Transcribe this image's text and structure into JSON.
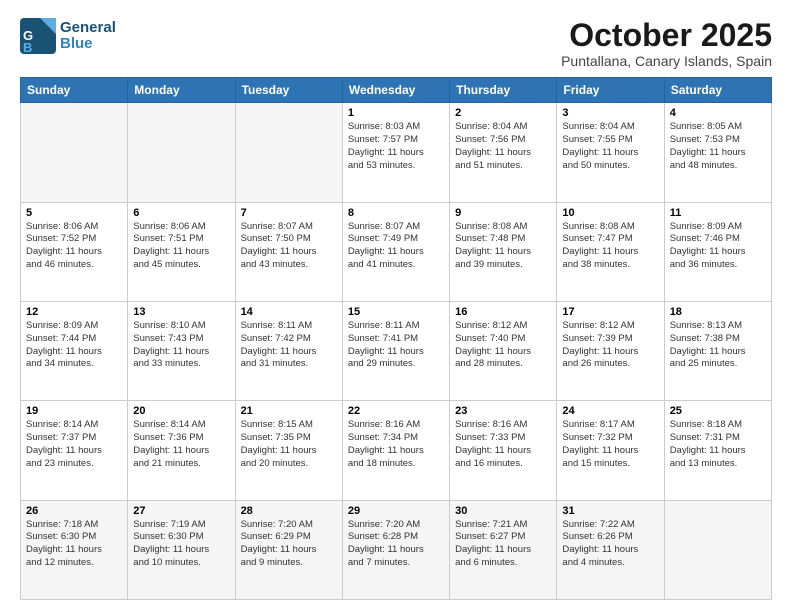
{
  "header": {
    "logo_line1": "General",
    "logo_line2": "Blue",
    "month": "October 2025",
    "location": "Puntallana, Canary Islands, Spain"
  },
  "weekdays": [
    "Sunday",
    "Monday",
    "Tuesday",
    "Wednesday",
    "Thursday",
    "Friday",
    "Saturday"
  ],
  "weeks": [
    [
      {
        "day": "",
        "text": ""
      },
      {
        "day": "",
        "text": ""
      },
      {
        "day": "",
        "text": ""
      },
      {
        "day": "1",
        "text": "Sunrise: 8:03 AM\nSunset: 7:57 PM\nDaylight: 11 hours\nand 53 minutes."
      },
      {
        "day": "2",
        "text": "Sunrise: 8:04 AM\nSunset: 7:56 PM\nDaylight: 11 hours\nand 51 minutes."
      },
      {
        "day": "3",
        "text": "Sunrise: 8:04 AM\nSunset: 7:55 PM\nDaylight: 11 hours\nand 50 minutes."
      },
      {
        "day": "4",
        "text": "Sunrise: 8:05 AM\nSunset: 7:53 PM\nDaylight: 11 hours\nand 48 minutes."
      }
    ],
    [
      {
        "day": "5",
        "text": "Sunrise: 8:06 AM\nSunset: 7:52 PM\nDaylight: 11 hours\nand 46 minutes."
      },
      {
        "day": "6",
        "text": "Sunrise: 8:06 AM\nSunset: 7:51 PM\nDaylight: 11 hours\nand 45 minutes."
      },
      {
        "day": "7",
        "text": "Sunrise: 8:07 AM\nSunset: 7:50 PM\nDaylight: 11 hours\nand 43 minutes."
      },
      {
        "day": "8",
        "text": "Sunrise: 8:07 AM\nSunset: 7:49 PM\nDaylight: 11 hours\nand 41 minutes."
      },
      {
        "day": "9",
        "text": "Sunrise: 8:08 AM\nSunset: 7:48 PM\nDaylight: 11 hours\nand 39 minutes."
      },
      {
        "day": "10",
        "text": "Sunrise: 8:08 AM\nSunset: 7:47 PM\nDaylight: 11 hours\nand 38 minutes."
      },
      {
        "day": "11",
        "text": "Sunrise: 8:09 AM\nSunset: 7:46 PM\nDaylight: 11 hours\nand 36 minutes."
      }
    ],
    [
      {
        "day": "12",
        "text": "Sunrise: 8:09 AM\nSunset: 7:44 PM\nDaylight: 11 hours\nand 34 minutes."
      },
      {
        "day": "13",
        "text": "Sunrise: 8:10 AM\nSunset: 7:43 PM\nDaylight: 11 hours\nand 33 minutes."
      },
      {
        "day": "14",
        "text": "Sunrise: 8:11 AM\nSunset: 7:42 PM\nDaylight: 11 hours\nand 31 minutes."
      },
      {
        "day": "15",
        "text": "Sunrise: 8:11 AM\nSunset: 7:41 PM\nDaylight: 11 hours\nand 29 minutes."
      },
      {
        "day": "16",
        "text": "Sunrise: 8:12 AM\nSunset: 7:40 PM\nDaylight: 11 hours\nand 28 minutes."
      },
      {
        "day": "17",
        "text": "Sunrise: 8:12 AM\nSunset: 7:39 PM\nDaylight: 11 hours\nand 26 minutes."
      },
      {
        "day": "18",
        "text": "Sunrise: 8:13 AM\nSunset: 7:38 PM\nDaylight: 11 hours\nand 25 minutes."
      }
    ],
    [
      {
        "day": "19",
        "text": "Sunrise: 8:14 AM\nSunset: 7:37 PM\nDaylight: 11 hours\nand 23 minutes."
      },
      {
        "day": "20",
        "text": "Sunrise: 8:14 AM\nSunset: 7:36 PM\nDaylight: 11 hours\nand 21 minutes."
      },
      {
        "day": "21",
        "text": "Sunrise: 8:15 AM\nSunset: 7:35 PM\nDaylight: 11 hours\nand 20 minutes."
      },
      {
        "day": "22",
        "text": "Sunrise: 8:16 AM\nSunset: 7:34 PM\nDaylight: 11 hours\nand 18 minutes."
      },
      {
        "day": "23",
        "text": "Sunrise: 8:16 AM\nSunset: 7:33 PM\nDaylight: 11 hours\nand 16 minutes."
      },
      {
        "day": "24",
        "text": "Sunrise: 8:17 AM\nSunset: 7:32 PM\nDaylight: 11 hours\nand 15 minutes."
      },
      {
        "day": "25",
        "text": "Sunrise: 8:18 AM\nSunset: 7:31 PM\nDaylight: 11 hours\nand 13 minutes."
      }
    ],
    [
      {
        "day": "26",
        "text": "Sunrise: 7:18 AM\nSunset: 6:30 PM\nDaylight: 11 hours\nand 12 minutes."
      },
      {
        "day": "27",
        "text": "Sunrise: 7:19 AM\nSunset: 6:30 PM\nDaylight: 11 hours\nand 10 minutes."
      },
      {
        "day": "28",
        "text": "Sunrise: 7:20 AM\nSunset: 6:29 PM\nDaylight: 11 hours\nand 9 minutes."
      },
      {
        "day": "29",
        "text": "Sunrise: 7:20 AM\nSunset: 6:28 PM\nDaylight: 11 hours\nand 7 minutes."
      },
      {
        "day": "30",
        "text": "Sunrise: 7:21 AM\nSunset: 6:27 PM\nDaylight: 11 hours\nand 6 minutes."
      },
      {
        "day": "31",
        "text": "Sunrise: 7:22 AM\nSunset: 6:26 PM\nDaylight: 11 hours\nand 4 minutes."
      },
      {
        "day": "",
        "text": ""
      }
    ]
  ]
}
